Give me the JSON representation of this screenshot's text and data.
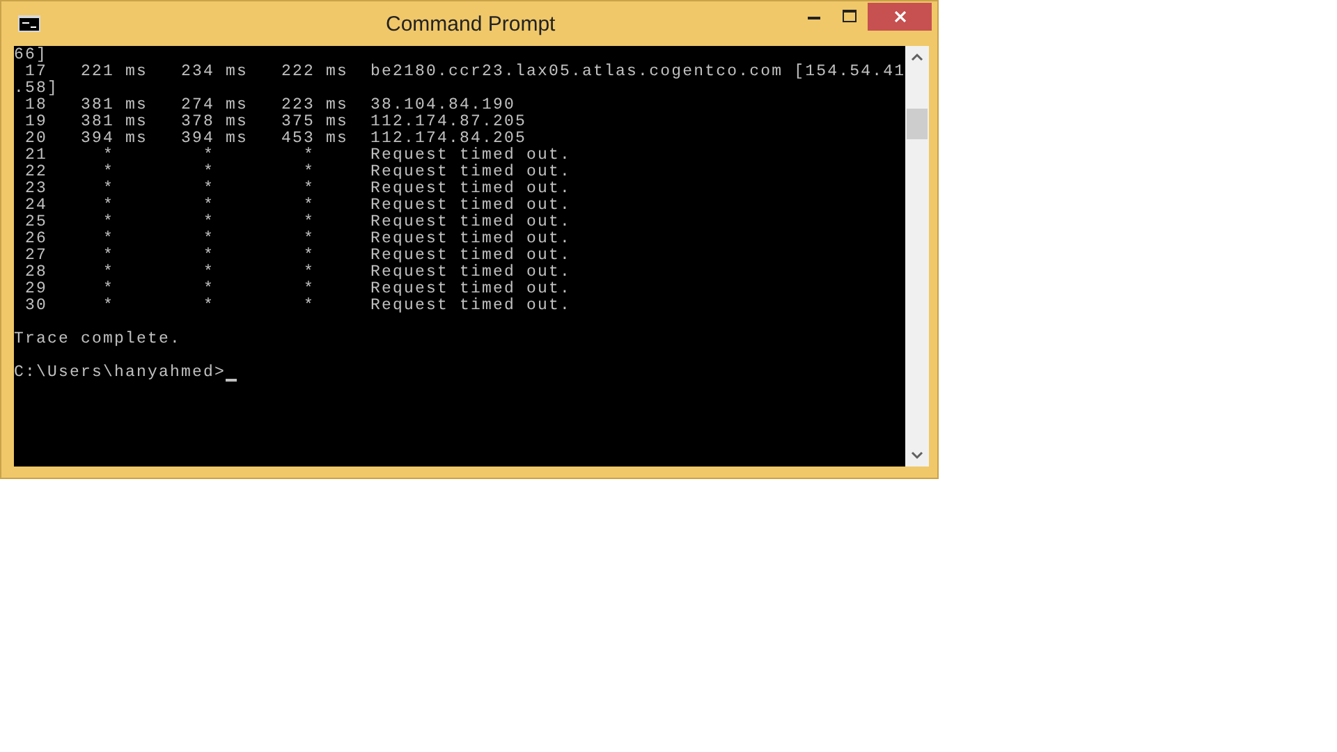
{
  "window": {
    "title": "Command Prompt"
  },
  "console": {
    "lines": [
      "66]",
      " 17   221 ms   234 ms   222 ms  be2180.ccr23.lax05.atlas.cogentco.com [154.54.41",
      ".58]",
      " 18   381 ms   274 ms   223 ms  38.104.84.190",
      " 19   381 ms   378 ms   375 ms  112.174.87.205",
      " 20   394 ms   394 ms   453 ms  112.174.84.205",
      " 21     *        *        *     Request timed out.",
      " 22     *        *        *     Request timed out.",
      " 23     *        *        *     Request timed out.",
      " 24     *        *        *     Request timed out.",
      " 25     *        *        *     Request timed out.",
      " 26     *        *        *     Request timed out.",
      " 27     *        *        *     Request timed out.",
      " 28     *        *        *     Request timed out.",
      " 29     *        *        *     Request timed out.",
      " 30     *        *        *     Request timed out."
    ],
    "summary": "Trace complete.",
    "prompt": "C:\\Users\\hanyahmed>"
  }
}
